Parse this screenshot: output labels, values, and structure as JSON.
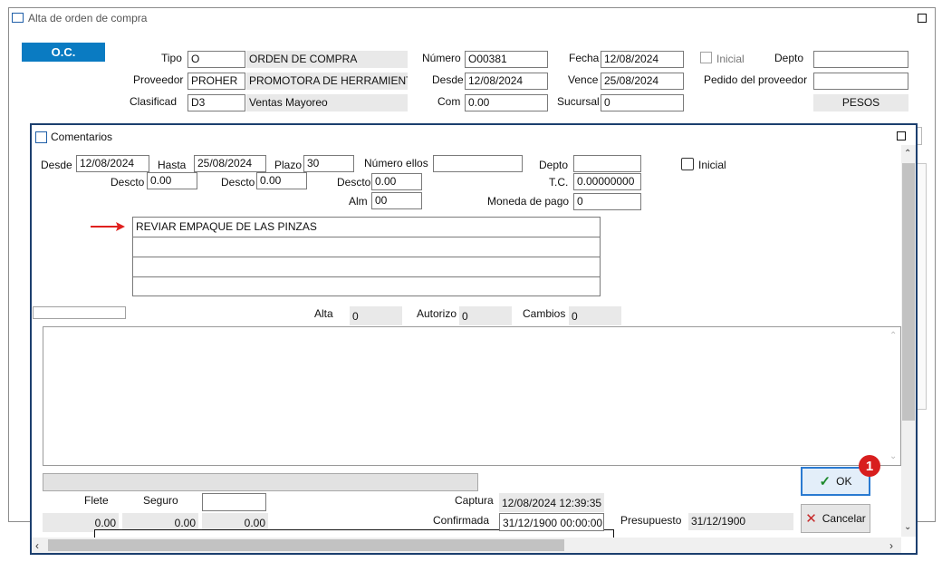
{
  "outer": {
    "title": "Alta de orden de compra",
    "oc_label": "O.C.",
    "tipo_label": "Tipo",
    "tipo_code": "O",
    "tipo_desc": "ORDEN DE COMPRA",
    "proveedor_label": "Proveedor",
    "proveedor_code": "PROHER",
    "proveedor_desc": "PROMOTORA DE HERRAMIENTAS",
    "clasificad_label": "Clasificad",
    "clasificad_code": "D3",
    "clasificad_desc": "Ventas Mayoreo",
    "numero_label": "Número",
    "numero_value": "O00381",
    "desde_label": "Desde",
    "desde_value": "12/08/2024",
    "com_label": "Com",
    "com_value": "0.00",
    "fecha_label": "Fecha",
    "fecha_value": "12/08/2024",
    "vence_label": "Vence",
    "vence_value": "25/08/2024",
    "sucursal_label": "Sucursal",
    "sucursal_value": "0",
    "inicial_label": "Inicial",
    "depto_label": "Depto",
    "depto_value": "",
    "pedido_label": "Pedido del proveedor",
    "pedido_value": "",
    "moneda_value": "PESOS"
  },
  "dialog": {
    "title": "Comentarios",
    "desde_label": "Desde",
    "desde_value": "12/08/2024",
    "hasta_label": "Hasta",
    "hasta_value": "25/08/2024",
    "plazo_label": "Plazo",
    "plazo_value": "30",
    "numero_ellos_label": "Número ellos",
    "numero_ellos_value": "",
    "depto_label": "Depto",
    "depto_value": "",
    "inicial_label": "Inicial",
    "descto1_label": "Descto",
    "descto1_value": "0.00",
    "descto2_label": "Descto",
    "descto2_value": "0.00",
    "descto3_label": "Descto",
    "descto3_value": "0.00",
    "tc_label": "T.C.",
    "tc_value": "0.00000000",
    "alm_label": "Alm",
    "alm_value": "00",
    "moneda_pago_label": "Moneda de pago",
    "moneda_pago_value": "0",
    "comment_lines": [
      "REVIAR EMPAQUE DE LAS PINZAS",
      "",
      "",
      ""
    ],
    "alta_label": "Alta",
    "alta_value": "0",
    "autorizo_label": "Autorizo",
    "autorizo_value": "0",
    "cambios_label": "Cambios",
    "cambios_value": "0",
    "flete_label": "Flete",
    "flete_value": "0.00",
    "seguro_label": "Seguro",
    "seguro_value": "0.00",
    "third_value": "0.00",
    "captura_label": "Captura",
    "captura_value": "12/08/2024 12:39:35",
    "confirmada_label": "Confirmada",
    "confirmada_value": "31/12/1900 00:00:00",
    "presupuesto_label": "Presupuesto",
    "presupuesto_value": "31/12/1900",
    "ok_label": "OK",
    "cancel_label": "Cancelar",
    "step_badge": "1"
  },
  "colors": {
    "accent": "#0a7bc2",
    "dialog_border": "#1c3f6e",
    "arrow": "#e0201e",
    "badge": "#d81e1e"
  }
}
